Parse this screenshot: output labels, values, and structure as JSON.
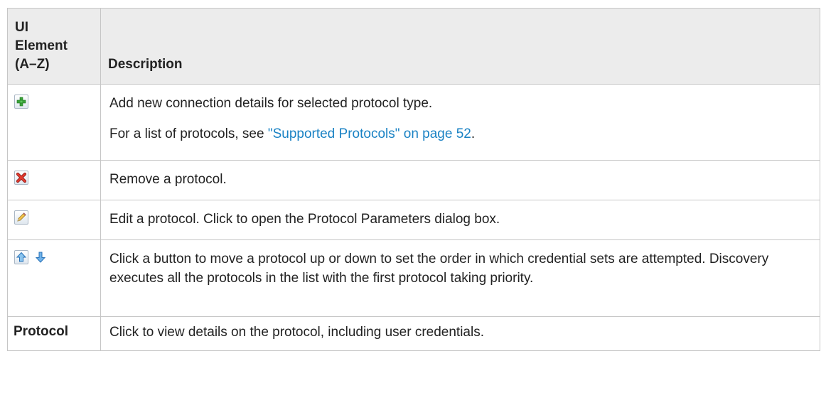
{
  "header": {
    "col1": [
      "UI",
      "Element",
      "(A–Z)"
    ],
    "col2": "Description"
  },
  "rows": [
    {
      "icon": "add-icon",
      "paragraphs": [
        "Add new connection details for selected protocol type."
      ],
      "link_prefix": "For a list of protocols, see ",
      "link_text": "\"Supported Protocols\" on page 52",
      "link_suffix": "."
    },
    {
      "icon": "remove-icon",
      "text": "Remove a protocol."
    },
    {
      "icon": "edit-pencil-icon",
      "text": "Edit a protocol. Click to open the Protocol Parameters dialog box."
    },
    {
      "icons": [
        "move-up-icon",
        "move-down-icon"
      ],
      "text": "Click a button to move a protocol up or down to set the order in which credential sets are attempted. Discovery executes all the protocols in the list with the first protocol taking priority."
    },
    {
      "label": "Protocol",
      "text": "Click to view details on the protocol, including user credentials."
    }
  ],
  "colors": {
    "link": "#1a82c4",
    "header_bg": "#ececec",
    "border": "#c6c6c6"
  }
}
